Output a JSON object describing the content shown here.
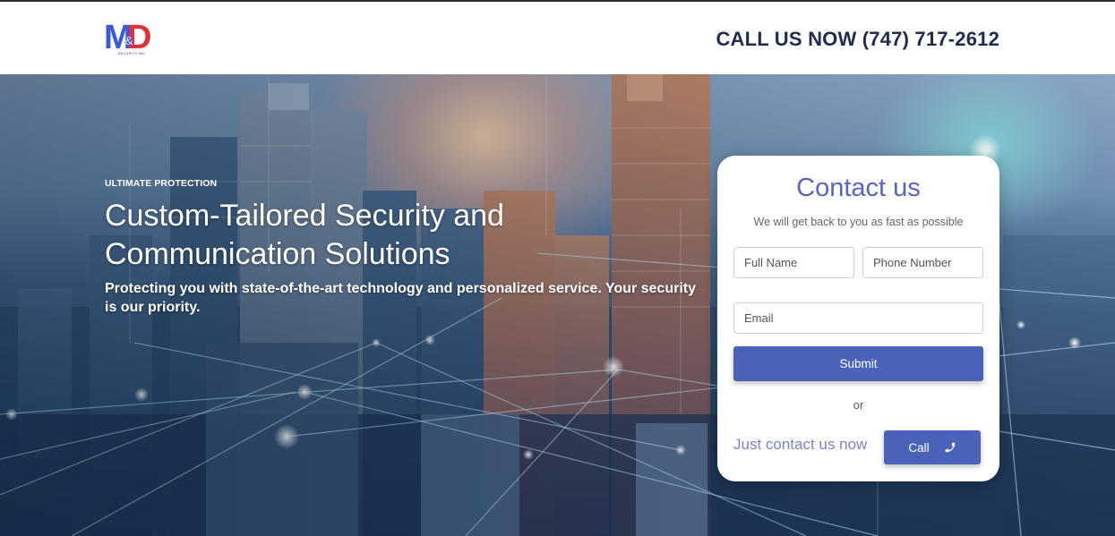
{
  "brand": {
    "logo_letters": "MD",
    "logo_tagline": "SECURITY INC",
    "colors": {
      "m": "#3a5bd9",
      "d": "#e0313a"
    }
  },
  "header": {
    "call_now": "CALL US NOW (747) 717-2612"
  },
  "hero": {
    "kicker": "ULTIMATE PROTECTION",
    "headline_line1": "Custom-Tailored Security and",
    "headline_line2": "Communication Solutions",
    "subheadline": "Protecting you with state-of-the-art technology and personalized service. Your security is our priority."
  },
  "contact_form": {
    "title": "Contact us",
    "subtitle": "We will get back to you as fast as possible",
    "full_name_placeholder": "Full Name",
    "phone_placeholder": "Phone Number",
    "email_placeholder": "Email",
    "submit_label": "Submit",
    "or_label": "or",
    "just_contact_label": "Just contact us now",
    "call_label": "Call",
    "call_icon": "phone-icon",
    "accent_color": "#4a63b9"
  }
}
